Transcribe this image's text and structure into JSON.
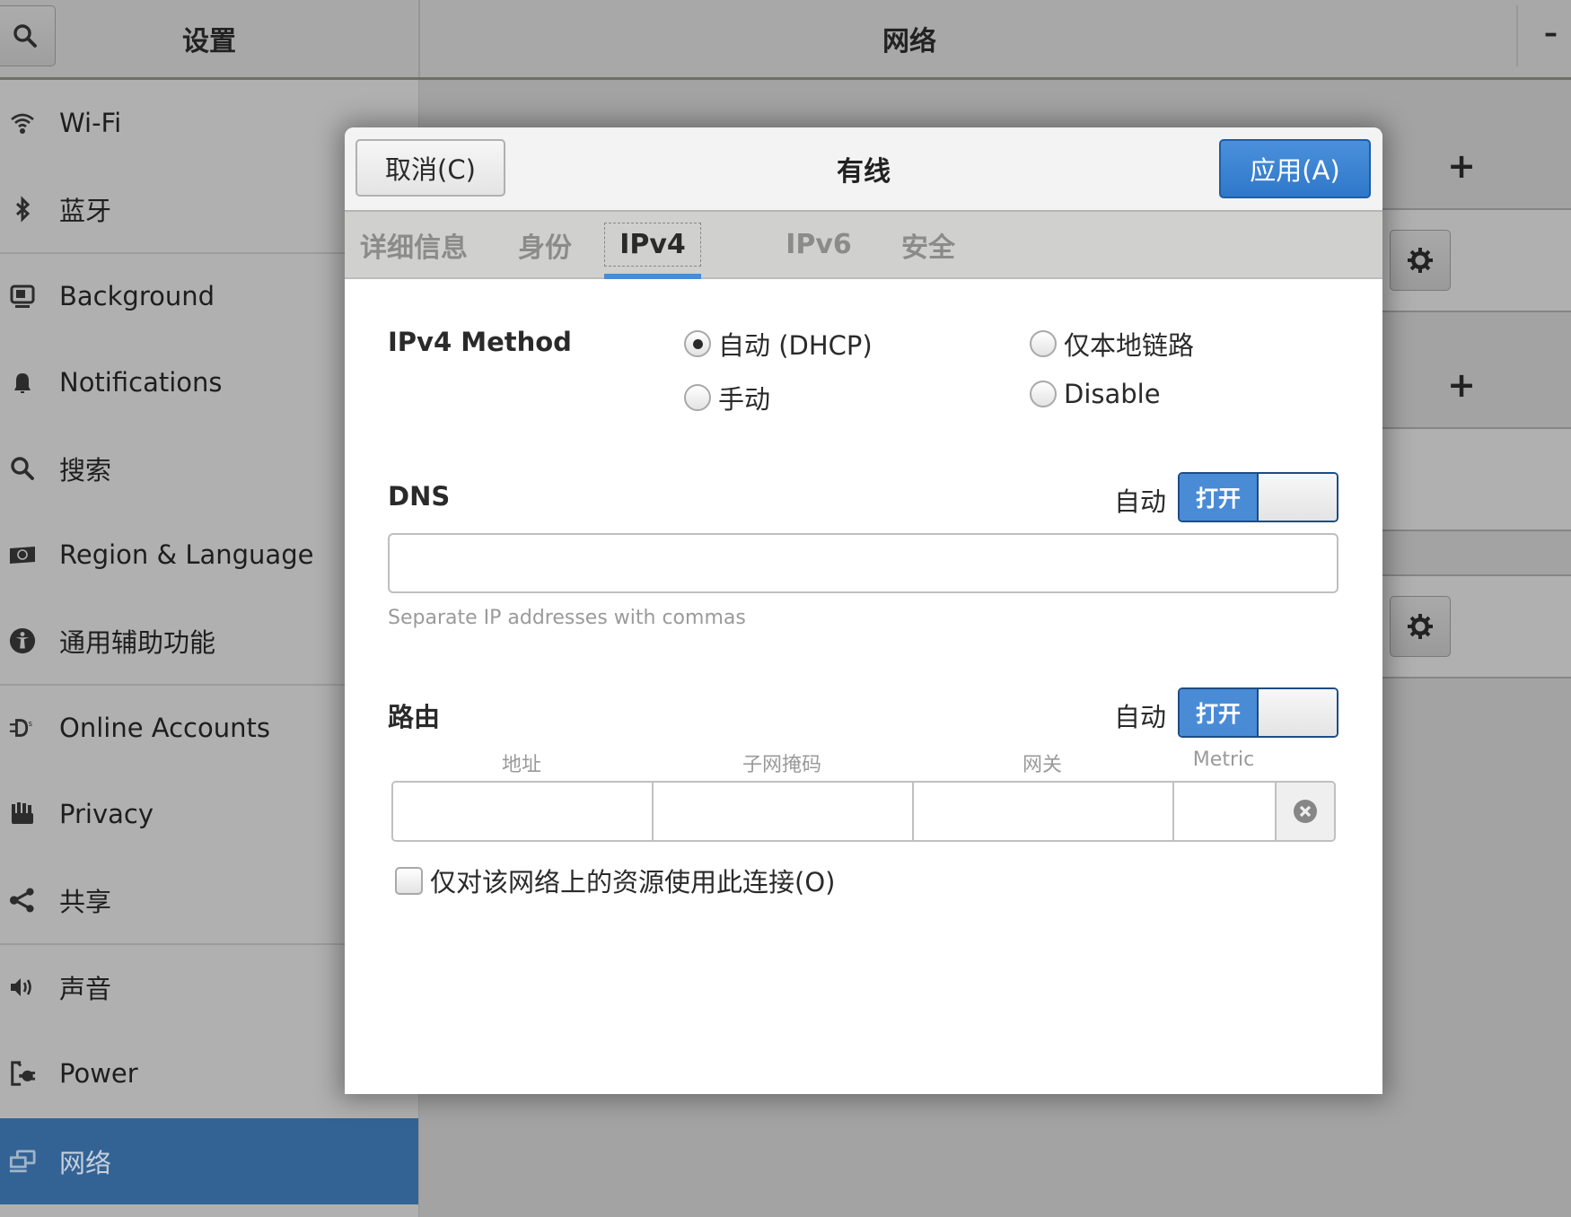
{
  "header": {
    "sidebar_title": "设置",
    "main_title": "网络",
    "search_icon": "search-icon",
    "minimize_label": "–"
  },
  "sidebar": {
    "items": [
      {
        "label": "Wi-Fi",
        "icon": "wifi-icon",
        "active": false
      },
      {
        "label": "蓝牙",
        "icon": "bluetooth-icon",
        "active": false
      },
      {
        "label": "Background",
        "icon": "background-icon",
        "active": false
      },
      {
        "label": "Notifications",
        "icon": "bell-icon",
        "active": false
      },
      {
        "label": "搜索",
        "icon": "search-icon",
        "active": false
      },
      {
        "label": "Region & Language",
        "icon": "region-icon",
        "active": false
      },
      {
        "label": "通用辅助功能",
        "icon": "accessibility-icon",
        "active": false
      },
      {
        "label": "Online Accounts",
        "icon": "online-accounts-icon",
        "active": false
      },
      {
        "label": "Privacy",
        "icon": "privacy-hand-icon",
        "active": false
      },
      {
        "label": "共享",
        "icon": "share-icon",
        "active": false
      },
      {
        "label": "声音",
        "icon": "speaker-icon",
        "active": false
      },
      {
        "label": "Power",
        "icon": "power-icon",
        "active": false
      },
      {
        "label": "网络",
        "icon": "network-icon",
        "active": true
      }
    ]
  },
  "main": {
    "add_label": "+",
    "settings_icon": "gear-icon"
  },
  "dialog": {
    "title": "有线",
    "cancel_label": "取消(C)",
    "apply_label": "应用(A)",
    "tabs": [
      {
        "label": "详细信息",
        "active": false
      },
      {
        "label": "身份",
        "active": false
      },
      {
        "label": "IPv4",
        "active": true
      },
      {
        "label": "IPv6",
        "active": false
      },
      {
        "label": "安全",
        "active": false
      }
    ],
    "ipv4": {
      "method_label": "IPv4 Method",
      "methods": [
        {
          "label": "自动 (DHCP)",
          "selected": true
        },
        {
          "label": "仅本地链路",
          "selected": false
        },
        {
          "label": "手动",
          "selected": false
        },
        {
          "label": "Disable",
          "selected": false
        }
      ],
      "dns": {
        "label": "DNS",
        "auto_label": "自动",
        "switch_label": "打开",
        "switch_on": true,
        "value": "",
        "hint": "Separate IP addresses with commas"
      },
      "routes": {
        "label": "路由",
        "auto_label": "自动",
        "switch_label": "打开",
        "switch_on": true,
        "columns": [
          "地址",
          "子网掩码",
          "网关",
          "Metric"
        ],
        "rows": [
          {
            "address": "",
            "netmask": "",
            "gateway": "",
            "metric": ""
          }
        ]
      },
      "only_local_resources": {
        "label": "仅对该网络上的资源使用此连接(O)",
        "checked": false
      }
    }
  },
  "colors": {
    "accent": "#4a8bd6",
    "apply_button": "#3580d0",
    "sidebar_active": "#336395"
  }
}
